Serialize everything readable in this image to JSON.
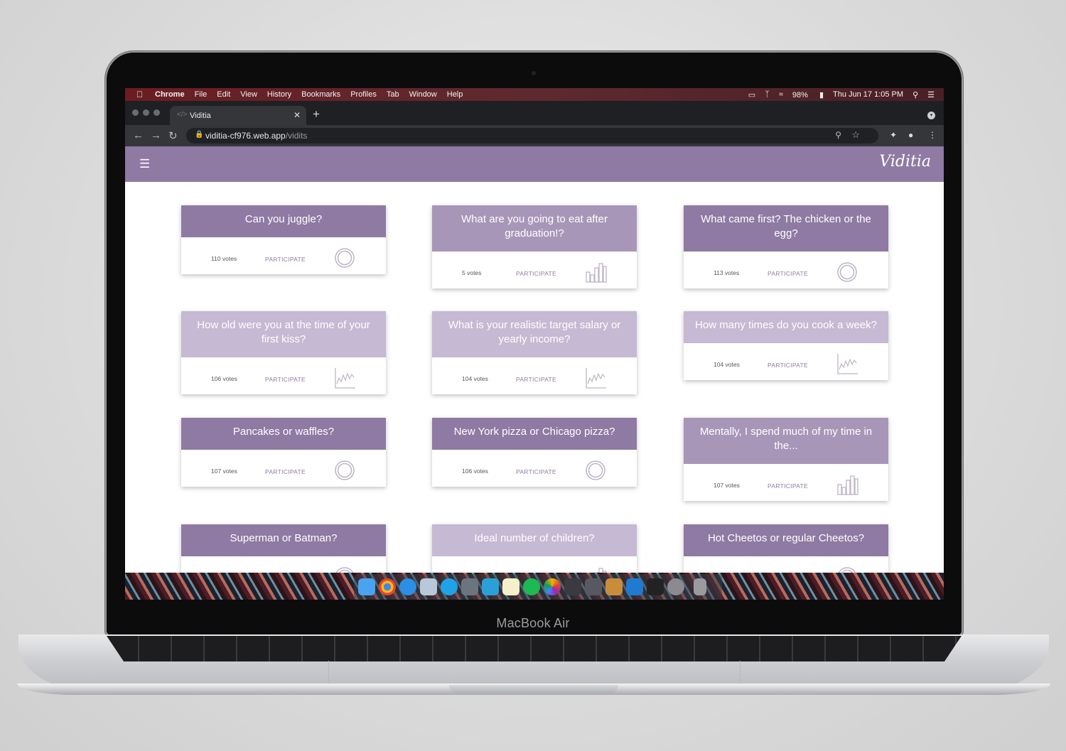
{
  "menubar": {
    "items": [
      "Chrome",
      "File",
      "Edit",
      "View",
      "History",
      "Bookmarks",
      "Profiles",
      "Tab",
      "Window",
      "Help"
    ],
    "battery": "98%",
    "datetime": "Thu Jun 17  1:05 PM"
  },
  "browser": {
    "tab_title": "Viditia",
    "url_host": "viditia-cf976.web.app",
    "url_path": "/vidits"
  },
  "app": {
    "logo": "Viditia"
  },
  "colors": {
    "header": "#8f7aa3",
    "card_dark": "#8f7aa3",
    "card_light": "#c6b9d3",
    "card_mid": "#a896b8"
  },
  "cards": [
    {
      "question": "Can you juggle?",
      "votes": "110 votes",
      "action": "PARTICIPATE",
      "icon": "donut-chart-icon"
    },
    {
      "question": "What are you going to eat after graduation!?",
      "votes": "5 votes",
      "action": "PARTICIPATE",
      "icon": "bar-chart-icon"
    },
    {
      "question": "What came first? The chicken or the egg?",
      "votes": "113 votes",
      "action": "PARTICIPATE",
      "icon": "donut-chart-icon"
    },
    {
      "question": "How old were you at the time of your first kiss?",
      "votes": "106 votes",
      "action": "PARTICIPATE",
      "icon": "line-chart-icon"
    },
    {
      "question": "What is your realistic target salary or yearly income?",
      "votes": "104 votes",
      "action": "PARTICIPATE",
      "icon": "line-chart-icon"
    },
    {
      "question": "How many times do you cook a week?",
      "votes": "104 votes",
      "action": "PARTICIPATE",
      "icon": "line-chart-icon"
    },
    {
      "question": "Pancakes or waffles?",
      "votes": "107 votes",
      "action": "PARTICIPATE",
      "icon": "donut-chart-icon"
    },
    {
      "question": "New York pizza or Chicago pizza?",
      "votes": "106 votes",
      "action": "PARTICIPATE",
      "icon": "donut-chart-icon"
    },
    {
      "question": "Mentally, I spend much of my time in the...",
      "votes": "107 votes",
      "action": "PARTICIPATE",
      "icon": "bar-chart-icon"
    },
    {
      "question": "Superman or Batman?",
      "icon": "donut-chart-icon"
    },
    {
      "question": "Ideal number of children?",
      "icon": "bar-chart-icon"
    },
    {
      "question": "Hot Cheetos or regular Cheetos?",
      "icon": "donut-chart-icon"
    }
  ],
  "laptop": {
    "model": "MacBook Air"
  }
}
